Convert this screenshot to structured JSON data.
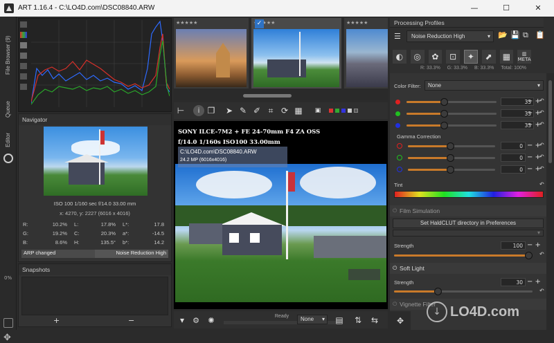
{
  "window": {
    "title": "ART 1.16.4 - C:\\LO4D.com\\DSC08840.ARW",
    "min": "—",
    "max": "☐",
    "close": "✕"
  },
  "left_tabs": {
    "file_browser": "File Browser (9)",
    "queue": "Queue",
    "editor": "Editor",
    "percent": "0%"
  },
  "navigator": {
    "title": "Navigator",
    "exif": "ISO 100   1/160 sec   f/14.0   33.00 mm",
    "coords": "x: 4270, y: 2227   (6016 x 4016)",
    "r_label": "R:",
    "r_val": "10.2%",
    "g_label": "G:",
    "g_val": "19.2%",
    "b_label": "B:",
    "b_val": "8.6%",
    "l_label": "L:",
    "l_val": "17.8%",
    "c_label": "C:",
    "c_val": "20.3%",
    "h_label": "H:",
    "h_val": "135.5°",
    "ls_label": "L*:",
    "ls_val": "17.8",
    "as_label": "a*:",
    "as_val": "-14.5",
    "bs_label": "b*:",
    "bs_val": "14.2"
  },
  "history": {
    "item1": "ARP changed",
    "item2": "Noise Reduction High"
  },
  "snapshots": {
    "title": "Snapshots",
    "add": "+",
    "remove": "−"
  },
  "overlay": {
    "camera": "SONY ILCE-7M2  +  FE 24-70mm F4 ZA OSS",
    "settings": "f/14.0   1/160s   ISO100   33.00mm",
    "file": "C:\\LO4D.com\\DSC08840.ARW",
    "mp": "24.2 MP (6016x4016)"
  },
  "bottom_bar": {
    "status": "Ready",
    "none_label": "None"
  },
  "profiles": {
    "title": "Processing Profiles",
    "selected": "Noise Reduction High"
  },
  "readout": {
    "r": "R: 33.3%",
    "g": "G: 33.3%",
    "b": "B: 33.3%",
    "total": "Total: 100%"
  },
  "tools": {
    "meta": "META"
  },
  "color_filter": {
    "label": "Color Filter:",
    "value": "None"
  },
  "channels": {
    "red": "33",
    "green": "33",
    "blue": "33"
  },
  "gamma": {
    "title": "Gamma Correction",
    "red": "0",
    "green": "0",
    "blue": "0"
  },
  "tint": {
    "label": "Tint"
  },
  "film": {
    "title": "Film Simulation",
    "button": "Set HaldCLUT directory in Preferences",
    "strength_label": "Strength",
    "strength": "100"
  },
  "soft": {
    "title": "Soft Light",
    "strength_label": "Strength",
    "strength": "30"
  },
  "vignette": {
    "title": "Vignette Filter"
  },
  "watermark": {
    "text": "LO4D.com"
  },
  "colors": {
    "accent": "#f5a623",
    "bg": "#2b2b2b",
    "panel": "#333333"
  }
}
